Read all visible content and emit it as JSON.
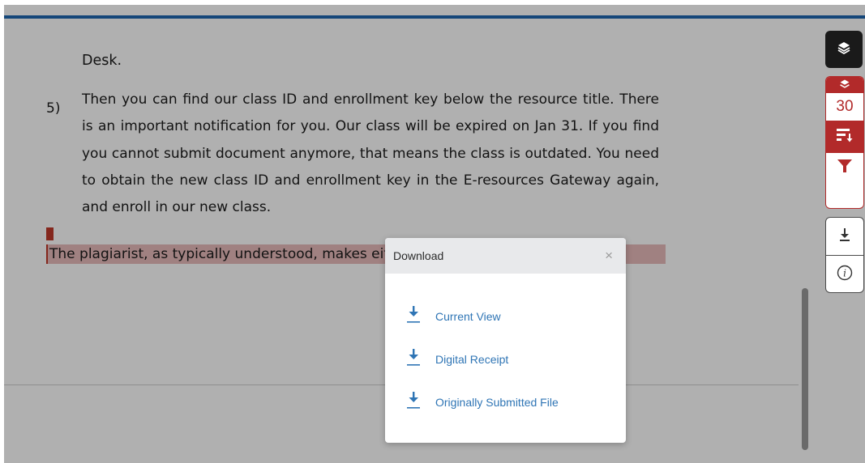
{
  "document": {
    "desk_text": "Desk.",
    "item_number": "5)",
    "paragraph": "Then you can find our class ID and enrollment key below the resource title. There is an important notification for you. Our class will be expired on Jan 31. If you find you cannot submit document anymore, that means the class is outdated. You need to obtain the new class ID and enrollment key in the E-resources Gateway again, and enroll in our new class.",
    "highlighted_sentence": "The plagiarist, as typically understood, makes either a deliberate or an uninformed"
  },
  "sidebar": {
    "match_count": "30",
    "icons": [
      "layers-icon",
      "layers-icon",
      "sort-icon",
      "filter-icon",
      "download-icon",
      "info-icon"
    ],
    "colors": {
      "accent_red": "#b22a2a",
      "dark": "#1a1a1a"
    }
  },
  "modal": {
    "title": "Download",
    "close_glyph": "×",
    "options": [
      {
        "label": "Current View"
      },
      {
        "label": "Digital Receipt"
      },
      {
        "label": "Originally Submitted File"
      }
    ],
    "link_color": "#2f75b5"
  }
}
